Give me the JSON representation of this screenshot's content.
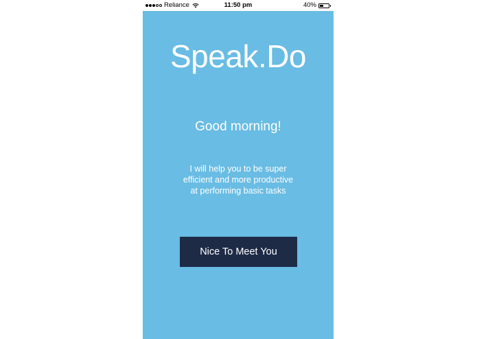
{
  "status_bar": {
    "carrier": "Reliance",
    "signal_bars_filled": 3,
    "signal_bars_total": 5,
    "time": "11:50 pm",
    "battery_percent_text": "40%",
    "battery_level": 0.4
  },
  "app": {
    "title": "Speak.Do",
    "greeting": "Good morning!",
    "description": "I will help you to be super efficient and more productive at performing basic tasks",
    "primary_button_label": "Nice To Meet You"
  },
  "colors": {
    "background": "#69bce3",
    "button": "#1e2b47",
    "text": "#ffffff"
  },
  "icons": {
    "signal": "signal-dots-icon",
    "wifi": "wifi-icon",
    "battery": "battery-icon"
  }
}
